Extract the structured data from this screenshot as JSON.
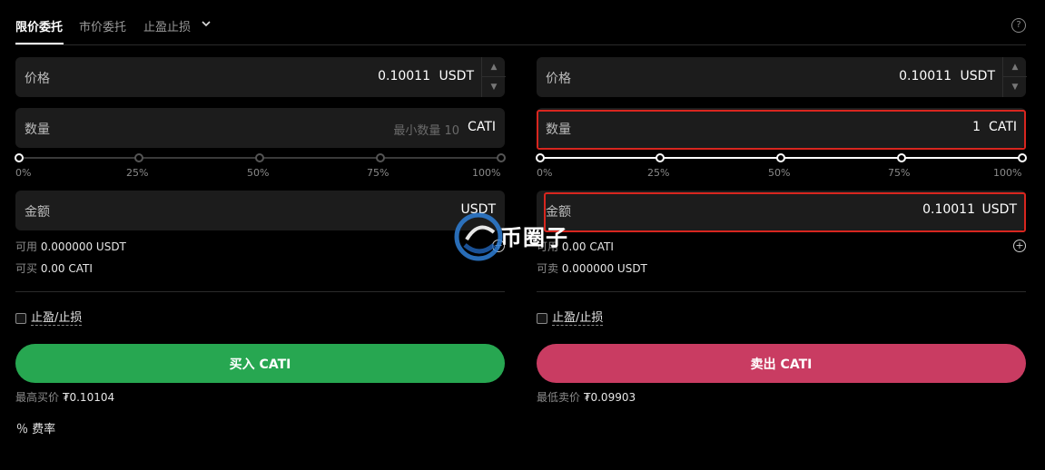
{
  "tabs": [
    {
      "label": "限价委托",
      "active": true
    },
    {
      "label": "市价委托",
      "active": false
    },
    {
      "label": "止盈止损",
      "active": false
    }
  ],
  "help_icon": "question-circle-icon",
  "slider_marks": [
    "0%",
    "25%",
    "50%",
    "75%",
    "100%"
  ],
  "buy": {
    "price_label": "价格",
    "price_value": "0.10011",
    "price_unit": "USDT",
    "qty_label": "数量",
    "qty_placeholder": "最小数量 10",
    "qty_unit": "CATI",
    "slider_fraction": 0,
    "amount_label": "金额",
    "amount_value": "",
    "amount_unit": "USDT",
    "available_label": "可用",
    "available_value": "0.000000 USDT",
    "can_label": "可买",
    "can_value": "0.00 CATI",
    "tpsl_label": "止盈/止损",
    "button_label": "买入 CATI",
    "button_color": "#27a751",
    "best_label": "最高买价",
    "best_value": "₮0.10104"
  },
  "sell": {
    "price_label": "价格",
    "price_value": "0.10011",
    "price_unit": "USDT",
    "qty_label": "数量",
    "qty_value": "1",
    "qty_unit": "CATI",
    "slider_fraction": 1,
    "amount_label": "金额",
    "amount_value": "0.10011",
    "amount_unit": "USDT",
    "available_label": "可用",
    "available_value": "0.00 CATI",
    "can_label": "可卖",
    "can_value": "0.000000 USDT",
    "tpsl_label": "止盈/止损",
    "button_label": "卖出 CATI",
    "button_color": "#c93c62",
    "best_label": "最低卖价",
    "best_value": "₮0.09903"
  },
  "fee_label": "％ 费率",
  "watermark_text": "币圈子"
}
